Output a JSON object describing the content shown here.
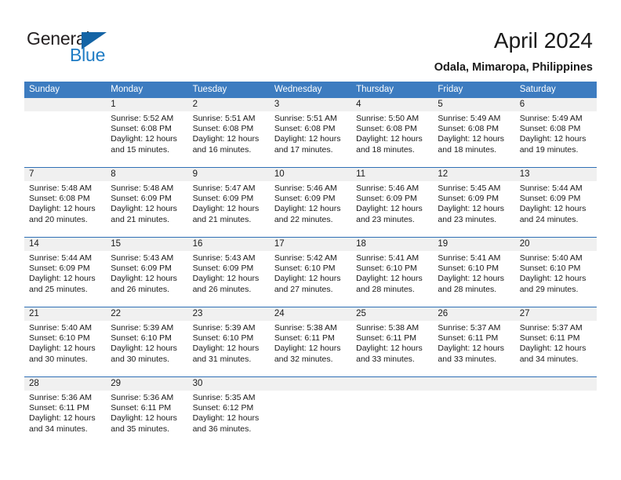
{
  "brand": {
    "name_part1": "General",
    "name_part2": "Blue",
    "triangle_color": "#1464a5",
    "blue_text_color": "#1f7cc4"
  },
  "header": {
    "title": "April 2024",
    "location": "Odala, Mimaropa, Philippines"
  },
  "theme": {
    "header_row_bg": "#3d7cc0",
    "week_separator": "#2f6fb5",
    "daynum_bg": "#f0f0f0",
    "page_bg": "#ffffff",
    "text": "#1a1a1a"
  },
  "calendar": {
    "weekday_headers": [
      "Sunday",
      "Monday",
      "Tuesday",
      "Wednesday",
      "Thursday",
      "Friday",
      "Saturday"
    ],
    "labels": {
      "sunrise_prefix": "Sunrise:",
      "sunset_prefix": "Sunset:",
      "daylight_prefix": "Daylight:"
    },
    "weeks": [
      [
        {
          "day": "",
          "sunrise": "",
          "sunset": "",
          "daylight_line1": "",
          "daylight_line2": "",
          "empty": true
        },
        {
          "day": "1",
          "sunrise": "Sunrise: 5:52 AM",
          "sunset": "Sunset: 6:08 PM",
          "daylight_line1": "Daylight: 12 hours",
          "daylight_line2": "and 15 minutes.",
          "empty": false
        },
        {
          "day": "2",
          "sunrise": "Sunrise: 5:51 AM",
          "sunset": "Sunset: 6:08 PM",
          "daylight_line1": "Daylight: 12 hours",
          "daylight_line2": "and 16 minutes.",
          "empty": false
        },
        {
          "day": "3",
          "sunrise": "Sunrise: 5:51 AM",
          "sunset": "Sunset: 6:08 PM",
          "daylight_line1": "Daylight: 12 hours",
          "daylight_line2": "and 17 minutes.",
          "empty": false
        },
        {
          "day": "4",
          "sunrise": "Sunrise: 5:50 AM",
          "sunset": "Sunset: 6:08 PM",
          "daylight_line1": "Daylight: 12 hours",
          "daylight_line2": "and 18 minutes.",
          "empty": false
        },
        {
          "day": "5",
          "sunrise": "Sunrise: 5:49 AM",
          "sunset": "Sunset: 6:08 PM",
          "daylight_line1": "Daylight: 12 hours",
          "daylight_line2": "and 18 minutes.",
          "empty": false
        },
        {
          "day": "6",
          "sunrise": "Sunrise: 5:49 AM",
          "sunset": "Sunset: 6:08 PM",
          "daylight_line1": "Daylight: 12 hours",
          "daylight_line2": "and 19 minutes.",
          "empty": false
        }
      ],
      [
        {
          "day": "7",
          "sunrise": "Sunrise: 5:48 AM",
          "sunset": "Sunset: 6:08 PM",
          "daylight_line1": "Daylight: 12 hours",
          "daylight_line2": "and 20 minutes.",
          "empty": false
        },
        {
          "day": "8",
          "sunrise": "Sunrise: 5:48 AM",
          "sunset": "Sunset: 6:09 PM",
          "daylight_line1": "Daylight: 12 hours",
          "daylight_line2": "and 21 minutes.",
          "empty": false
        },
        {
          "day": "9",
          "sunrise": "Sunrise: 5:47 AM",
          "sunset": "Sunset: 6:09 PM",
          "daylight_line1": "Daylight: 12 hours",
          "daylight_line2": "and 21 minutes.",
          "empty": false
        },
        {
          "day": "10",
          "sunrise": "Sunrise: 5:46 AM",
          "sunset": "Sunset: 6:09 PM",
          "daylight_line1": "Daylight: 12 hours",
          "daylight_line2": "and 22 minutes.",
          "empty": false
        },
        {
          "day": "11",
          "sunrise": "Sunrise: 5:46 AM",
          "sunset": "Sunset: 6:09 PM",
          "daylight_line1": "Daylight: 12 hours",
          "daylight_line2": "and 23 minutes.",
          "empty": false
        },
        {
          "day": "12",
          "sunrise": "Sunrise: 5:45 AM",
          "sunset": "Sunset: 6:09 PM",
          "daylight_line1": "Daylight: 12 hours",
          "daylight_line2": "and 23 minutes.",
          "empty": false
        },
        {
          "day": "13",
          "sunrise": "Sunrise: 5:44 AM",
          "sunset": "Sunset: 6:09 PM",
          "daylight_line1": "Daylight: 12 hours",
          "daylight_line2": "and 24 minutes.",
          "empty": false
        }
      ],
      [
        {
          "day": "14",
          "sunrise": "Sunrise: 5:44 AM",
          "sunset": "Sunset: 6:09 PM",
          "daylight_line1": "Daylight: 12 hours",
          "daylight_line2": "and 25 minutes.",
          "empty": false
        },
        {
          "day": "15",
          "sunrise": "Sunrise: 5:43 AM",
          "sunset": "Sunset: 6:09 PM",
          "daylight_line1": "Daylight: 12 hours",
          "daylight_line2": "and 26 minutes.",
          "empty": false
        },
        {
          "day": "16",
          "sunrise": "Sunrise: 5:43 AM",
          "sunset": "Sunset: 6:09 PM",
          "daylight_line1": "Daylight: 12 hours",
          "daylight_line2": "and 26 minutes.",
          "empty": false
        },
        {
          "day": "17",
          "sunrise": "Sunrise: 5:42 AM",
          "sunset": "Sunset: 6:10 PM",
          "daylight_line1": "Daylight: 12 hours",
          "daylight_line2": "and 27 minutes.",
          "empty": false
        },
        {
          "day": "18",
          "sunrise": "Sunrise: 5:41 AM",
          "sunset": "Sunset: 6:10 PM",
          "daylight_line1": "Daylight: 12 hours",
          "daylight_line2": "and 28 minutes.",
          "empty": false
        },
        {
          "day": "19",
          "sunrise": "Sunrise: 5:41 AM",
          "sunset": "Sunset: 6:10 PM",
          "daylight_line1": "Daylight: 12 hours",
          "daylight_line2": "and 28 minutes.",
          "empty": false
        },
        {
          "day": "20",
          "sunrise": "Sunrise: 5:40 AM",
          "sunset": "Sunset: 6:10 PM",
          "daylight_line1": "Daylight: 12 hours",
          "daylight_line2": "and 29 minutes.",
          "empty": false
        }
      ],
      [
        {
          "day": "21",
          "sunrise": "Sunrise: 5:40 AM",
          "sunset": "Sunset: 6:10 PM",
          "daylight_line1": "Daylight: 12 hours",
          "daylight_line2": "and 30 minutes.",
          "empty": false
        },
        {
          "day": "22",
          "sunrise": "Sunrise: 5:39 AM",
          "sunset": "Sunset: 6:10 PM",
          "daylight_line1": "Daylight: 12 hours",
          "daylight_line2": "and 30 minutes.",
          "empty": false
        },
        {
          "day": "23",
          "sunrise": "Sunrise: 5:39 AM",
          "sunset": "Sunset: 6:10 PM",
          "daylight_line1": "Daylight: 12 hours",
          "daylight_line2": "and 31 minutes.",
          "empty": false
        },
        {
          "day": "24",
          "sunrise": "Sunrise: 5:38 AM",
          "sunset": "Sunset: 6:11 PM",
          "daylight_line1": "Daylight: 12 hours",
          "daylight_line2": "and 32 minutes.",
          "empty": false
        },
        {
          "day": "25",
          "sunrise": "Sunrise: 5:38 AM",
          "sunset": "Sunset: 6:11 PM",
          "daylight_line1": "Daylight: 12 hours",
          "daylight_line2": "and 33 minutes.",
          "empty": false
        },
        {
          "day": "26",
          "sunrise": "Sunrise: 5:37 AM",
          "sunset": "Sunset: 6:11 PM",
          "daylight_line1": "Daylight: 12 hours",
          "daylight_line2": "and 33 minutes.",
          "empty": false
        },
        {
          "day": "27",
          "sunrise": "Sunrise: 5:37 AM",
          "sunset": "Sunset: 6:11 PM",
          "daylight_line1": "Daylight: 12 hours",
          "daylight_line2": "and 34 minutes.",
          "empty": false
        }
      ],
      [
        {
          "day": "28",
          "sunrise": "Sunrise: 5:36 AM",
          "sunset": "Sunset: 6:11 PM",
          "daylight_line1": "Daylight: 12 hours",
          "daylight_line2": "and 34 minutes.",
          "empty": false
        },
        {
          "day": "29",
          "sunrise": "Sunrise: 5:36 AM",
          "sunset": "Sunset: 6:11 PM",
          "daylight_line1": "Daylight: 12 hours",
          "daylight_line2": "and 35 minutes.",
          "empty": false
        },
        {
          "day": "30",
          "sunrise": "Sunrise: 5:35 AM",
          "sunset": "Sunset: 6:12 PM",
          "daylight_line1": "Daylight: 12 hours",
          "daylight_line2": "and 36 minutes.",
          "empty": false
        },
        {
          "day": "",
          "sunrise": "",
          "sunset": "",
          "daylight_line1": "",
          "daylight_line2": "",
          "empty": true
        },
        {
          "day": "",
          "sunrise": "",
          "sunset": "",
          "daylight_line1": "",
          "daylight_line2": "",
          "empty": true
        },
        {
          "day": "",
          "sunrise": "",
          "sunset": "",
          "daylight_line1": "",
          "daylight_line2": "",
          "empty": true
        },
        {
          "day": "",
          "sunrise": "",
          "sunset": "",
          "daylight_line1": "",
          "daylight_line2": "",
          "empty": true
        }
      ]
    ]
  }
}
